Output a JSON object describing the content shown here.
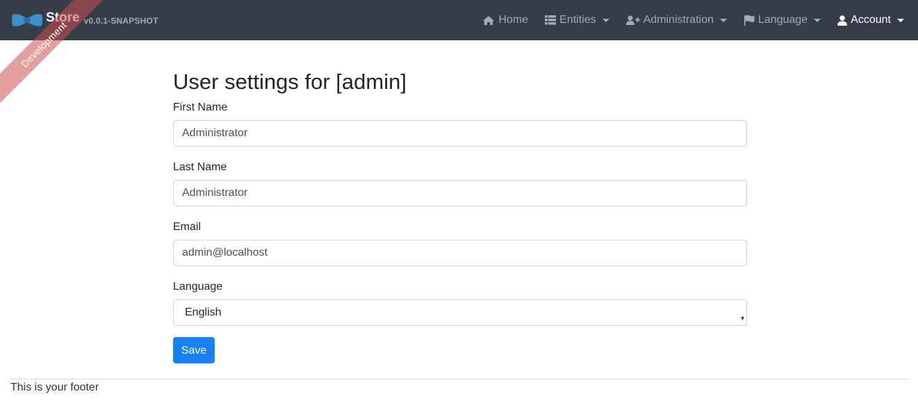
{
  "navbar": {
    "brand": {
      "title": "Store",
      "version": "v0.0.1-SNAPSHOT"
    },
    "ribbon": "Development",
    "items": [
      {
        "label": "Home",
        "icon": "home-icon",
        "dropdown": false
      },
      {
        "label": "Entities",
        "icon": "table-list-icon",
        "dropdown": true
      },
      {
        "label": "Administration",
        "icon": "user-plus-icon",
        "dropdown": true
      },
      {
        "label": "Language",
        "icon": "flag-icon",
        "dropdown": true
      },
      {
        "label": "Account",
        "icon": "user-icon",
        "dropdown": true
      }
    ]
  },
  "page": {
    "title_prefix": "User settings for [",
    "title_user": "admin",
    "title_suffix": "]"
  },
  "form": {
    "first_name": {
      "label": "First Name",
      "value": "Administrator"
    },
    "last_name": {
      "label": "Last Name",
      "value": "Administrator"
    },
    "email": {
      "label": "Email",
      "value": "admin@localhost"
    },
    "language": {
      "label": "Language",
      "value": "English"
    },
    "save_label": "Save"
  },
  "footer": {
    "text": "This is your footer"
  },
  "colors": {
    "navbar_bg": "#353d47",
    "primary": "#1a80f8",
    "ribbon": "#cd5050"
  }
}
